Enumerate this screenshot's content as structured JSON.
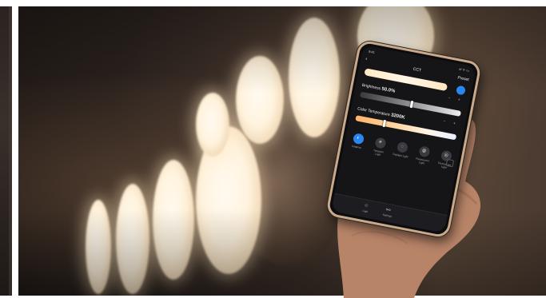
{
  "phone": {
    "status_time": "9:41",
    "status_icons": "ııl ᯤ ▭",
    "back_icon": "back-arrow-icon",
    "title": "CCT",
    "preset_label": "Preset",
    "brightness_label": "Brightness",
    "brightness_value": "50.0%",
    "brightness_level": 0.5,
    "cct_label": "Color Temperature",
    "cct_value": "3200K",
    "cct_level": 0.27,
    "step_controls": "− +",
    "modes": [
      {
        "icon": "dial-icon",
        "glyph": "◐",
        "label": "Adaptive"
      },
      {
        "icon": "sun-icon",
        "glyph": "☀",
        "label": "Tungsten Light"
      },
      {
        "icon": "daylight-icon",
        "glyph": "◌",
        "label": "Daylight Light"
      },
      {
        "icon": "fluorescent-icon",
        "glyph": "◍",
        "label": "Fluorescent Light"
      },
      {
        "icon": "fluorescent-alt-icon",
        "glyph": "◎",
        "label": "Fluorescent Light"
      }
    ],
    "tabs": [
      {
        "icon": "bulb-icon",
        "glyph": "⌾",
        "label": "Light"
      },
      {
        "icon": "sliders-icon",
        "glyph": "⚯",
        "label": "Settings"
      }
    ],
    "accent_color": "#2c86f2"
  }
}
